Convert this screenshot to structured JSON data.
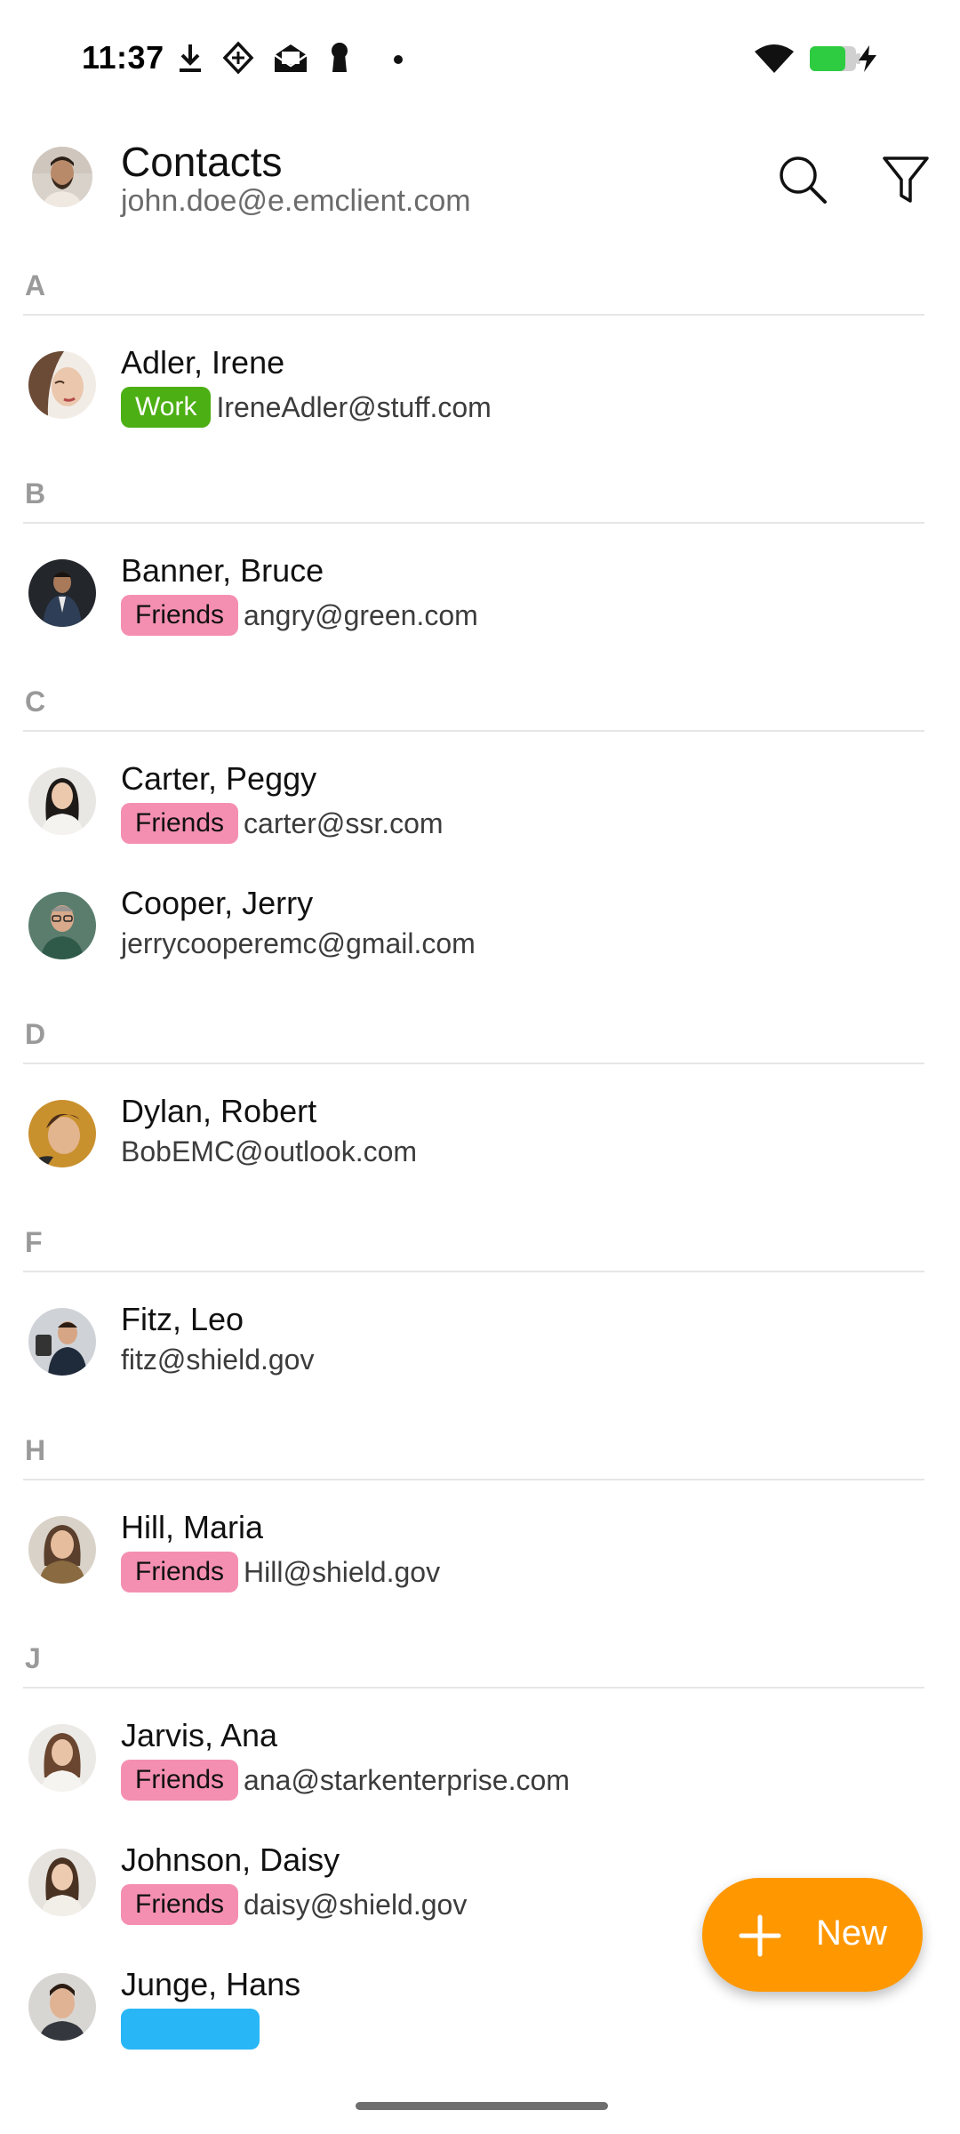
{
  "status_bar": {
    "time": "11:37",
    "icons": [
      "download-icon",
      "app-diamond-icon",
      "mail-open-icon",
      "keyhole-icon",
      "dot-icon",
      "wifi-icon",
      "battery-icon",
      "charging-bolt-icon"
    ],
    "battery_color": "#2ecc40"
  },
  "header": {
    "title": "Contacts",
    "account_email": "john.doe@e.emclient.com",
    "search_icon": "search-icon",
    "filter_icon": "filter-icon"
  },
  "colors": {
    "accent": "#ff9800",
    "tag_work": "#4caf13",
    "tag_friends": "#f48fb1",
    "tag_blue": "#29b6f6",
    "section_letter": "#9a9a9a"
  },
  "sections": [
    {
      "letter": "A",
      "contacts": [
        {
          "name": "Adler, Irene",
          "tag": "Work",
          "email": "IreneAdler@stuff.com"
        }
      ]
    },
    {
      "letter": "B",
      "contacts": [
        {
          "name": "Banner, Bruce",
          "tag": "Friends",
          "email": "angry@green.com"
        }
      ]
    },
    {
      "letter": "C",
      "contacts": [
        {
          "name": "Carter, Peggy",
          "tag": "Friends",
          "email": "carter@ssr.com"
        },
        {
          "name": "Cooper, Jerry",
          "tag": "",
          "email": "jerrycooperemc@gmail.com"
        }
      ]
    },
    {
      "letter": "D",
      "contacts": [
        {
          "name": "Dylan, Robert",
          "tag": "",
          "email": "BobEMC@outlook.com"
        }
      ]
    },
    {
      "letter": "F",
      "contacts": [
        {
          "name": "Fitz, Leo",
          "tag": "",
          "email": "fitz@shield.gov"
        }
      ]
    },
    {
      "letter": "H",
      "contacts": [
        {
          "name": "Hill, Maria",
          "tag": "Friends",
          "email": "Hill@shield.gov"
        }
      ]
    },
    {
      "letter": "J",
      "contacts": [
        {
          "name": "Jarvis, Ana",
          "tag": "Friends",
          "email": "ana@starkenterprise.com"
        },
        {
          "name": "Johnson, Daisy",
          "tag": "Friends",
          "email": "daisy@shield.gov"
        },
        {
          "name": "Junge, Hans",
          "tag": "",
          "email": ""
        }
      ]
    }
  ],
  "fab": {
    "label": "New",
    "icon": "plus-icon"
  }
}
